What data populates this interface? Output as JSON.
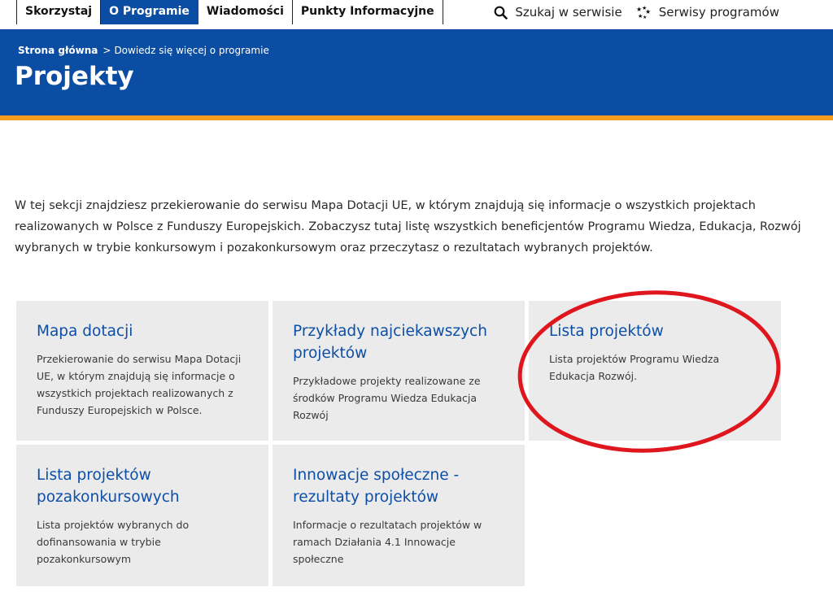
{
  "nav": {
    "items": [
      {
        "label": "Skorzystaj",
        "active": false
      },
      {
        "label": "O Programie",
        "active": true
      },
      {
        "label": "Wiadomości",
        "active": false
      },
      {
        "label": "Punkty Informacyjne",
        "active": false
      }
    ],
    "search_label": "Szukaj w serwisie",
    "search_icon": "search-icon",
    "services_label": "Serwisy programów",
    "services_icon": "eu-stars-icon"
  },
  "breadcrumb": {
    "home": "Strona główna",
    "separator": ">",
    "current": "Dowiedz się więcej o programie"
  },
  "page": {
    "title": "Projekty",
    "intro": "W tej sekcji znajdziesz przekierowanie do serwisu Mapa Dotacji UE, w którym znajdują się informacje o wszystkich projektach realizowanych w Polsce z Funduszy Europejskich. Zobaczysz tutaj listę wszystkich beneficjentów Programu Wiedza, Edukacja, Rozwój wybranych w trybie konkursowym i pozakonkursowym oraz przeczytasz o rezultatach wybranych projektów."
  },
  "tiles": [
    {
      "title": "Mapa dotacji",
      "desc": "Przekierowanie do serwisu Mapa Dotacji UE, w którym znajdują się informacje o wszystkich projektach realizowanych z Funduszy Europejskich w Polsce."
    },
    {
      "title": "Przykłady najciekawszych projektów",
      "desc": "Przykładowe projekty realizowane ze środków Programu Wiedza Edukacja Rozwój"
    },
    {
      "title": "Lista projektów",
      "desc": "Lista projektów Programu Wiedza Edukacja Rozwój."
    },
    {
      "title": "Lista projektów pozakonkursowych",
      "desc": "Lista projektów wybranych do dofinansowania w trybie pozakonkursowym"
    },
    {
      "title": "Innowacje społeczne - rezultaty projektów",
      "desc": "Informacje o rezultatach projektów w ramach Działania 4.1 Innowacje społeczne"
    }
  ],
  "colors": {
    "brand_blue": "#0b4da2",
    "accent_orange": "#f39c1d",
    "tile_bg": "#ebebeb",
    "annotation_red": "#e0161e"
  }
}
